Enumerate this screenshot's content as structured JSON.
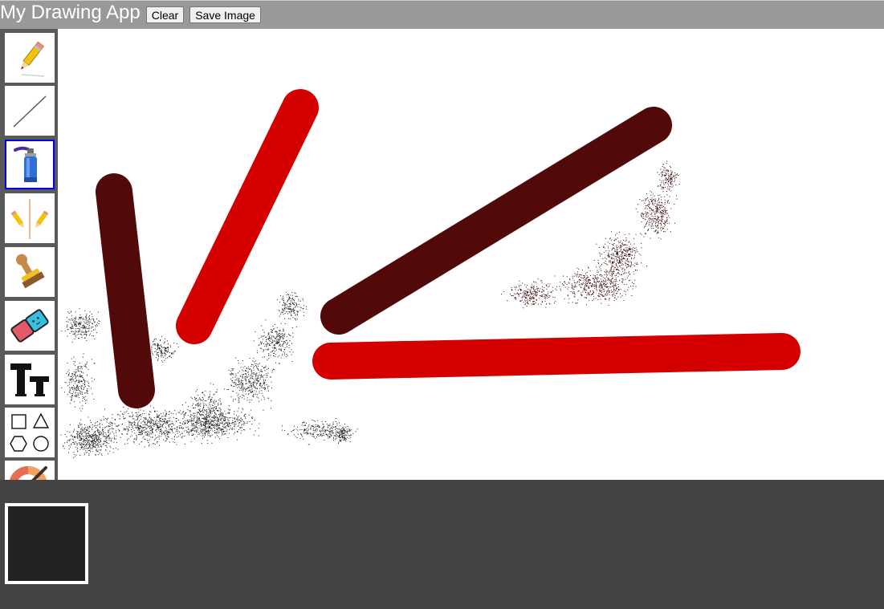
{
  "header": {
    "title": "My Drawing App",
    "clear_label": "Clear",
    "save_label": "Save Image"
  },
  "sidebar": {
    "tools": [
      {
        "name": "pencil",
        "icon": "pencil-icon",
        "selected": false
      },
      {
        "name": "line",
        "icon": "line-icon",
        "selected": false
      },
      {
        "name": "spray-can",
        "icon": "spray-can-icon",
        "selected": true
      },
      {
        "name": "mirror-draw",
        "icon": "mirror-pencils-icon",
        "selected": false
      },
      {
        "name": "stamp",
        "icon": "stamp-icon",
        "selected": false
      },
      {
        "name": "eraser",
        "icon": "eraser-icon",
        "selected": false
      },
      {
        "name": "text",
        "icon": "text-icon",
        "selected": false
      },
      {
        "name": "shapes",
        "icon": "shapes-icon",
        "selected": false
      },
      {
        "name": "color-picker",
        "icon": "color-wheel-icon",
        "selected": false
      }
    ]
  },
  "colors": {
    "header_bg": "#999999",
    "sidebar_bg": "#5a5a5a",
    "footer_bg": "#444444",
    "current_color": "#222222",
    "dark_stroke": "#520909",
    "red_stroke": "#d40000",
    "spray": "#1a1a1a"
  }
}
